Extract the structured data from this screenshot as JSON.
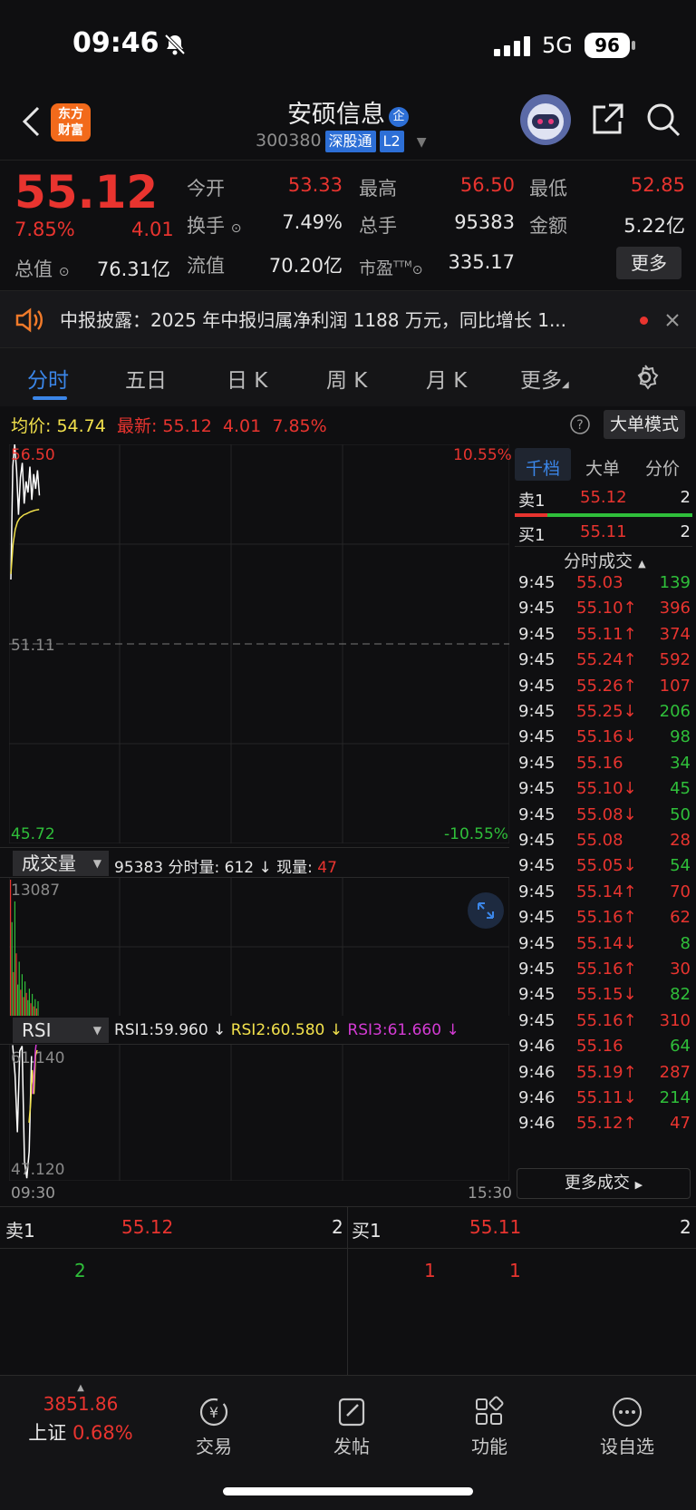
{
  "status": {
    "time": "09:46",
    "network": "5G",
    "battery": "96"
  },
  "header": {
    "logo_line1": "东方",
    "logo_line2": "财富",
    "title": "安硕信息",
    "title_badge": "企",
    "code": "300380",
    "badge1": "深股通",
    "badge2": "L2"
  },
  "quote": {
    "price": "55.12",
    "change_pct": "7.85%",
    "change": "4.01",
    "open_label": "今开",
    "open": "53.33",
    "high_label": "最高",
    "high": "56.50",
    "low_label": "最低",
    "low": "52.85",
    "turnover_label": "换手",
    "turnover": "7.49%",
    "volume_label": "总手",
    "volume": "95383",
    "amount_label": "金额",
    "amount": "5.22亿",
    "mktcap_label": "总值",
    "mktcap": "76.31亿",
    "float_label": "流值",
    "float": "70.20亿",
    "pe_label": "市盈",
    "pe_sup": "TTM",
    "pe": "335.17",
    "more": "更多"
  },
  "notice": {
    "text": "中报披露：2025 年中报归属净利润 1188 万元，同比增长 1..."
  },
  "tabs": [
    "分时",
    "五日",
    "日 K",
    "周 K",
    "月 K",
    "更多"
  ],
  "chart_header": {
    "avg_label": "均价:",
    "avg": "54.74",
    "latest_label": "最新:",
    "latest": "55.12",
    "chg": "4.01",
    "pct": "7.85%",
    "mode": "大单模式"
  },
  "chart_data": [
    {
      "type": "line",
      "title": "分时",
      "ylim": [
        45.72,
        56.5
      ],
      "y_top_label": "56.50",
      "y_mid_label": "51.11",
      "y_bottom_label": "45.72",
      "pct_top_label": "10.55%",
      "pct_bottom_label": "-10.55%",
      "x_start": "09:30",
      "x_end": "15:30",
      "series": [
        {
          "values": [
            52.85,
            55.9,
            56.5,
            55.8,
            54.6,
            55.6,
            56.0,
            54.9,
            55.5,
            55.2,
            55.9,
            55.0,
            55.7,
            55.3,
            55.8,
            55.12
          ]
        },
        {
          "values": [
            53.0,
            53.8,
            54.2,
            54.4,
            54.5,
            54.55,
            54.6,
            54.62,
            54.65,
            54.68,
            54.7,
            54.72,
            54.73,
            54.74
          ]
        }
      ]
    },
    {
      "type": "bar",
      "title": "成交量",
      "ymax_label": "13087",
      "ylim": [
        0,
        13087
      ],
      "values": [
        13087,
        9000,
        4200,
        11000,
        6000,
        3000,
        5200,
        2500,
        4000,
        1800,
        3300,
        2200,
        1500,
        2600,
        1200,
        2100,
        900,
        1600,
        700,
        1400
      ],
      "colors": [
        "red",
        "green",
        "red",
        "green",
        "red",
        "green",
        "green",
        "red",
        "green",
        "red",
        "green",
        "red",
        "green",
        "green",
        "red",
        "green",
        "red",
        "green",
        "red",
        "green"
      ]
    },
    {
      "type": "line",
      "title": "RSI",
      "ylim": [
        47.12,
        61.14
      ],
      "y_top_label": "61.140",
      "y_bottom_label": "47.120",
      "series": [
        {
          "name": "RSI1",
          "values": [
            61.1,
            58.0,
            52.0,
            60.5,
            61.0,
            49.0,
            47.2,
            50.0,
            59.96
          ]
        },
        {
          "name": "RSI2",
          "values": [
            53.0,
            55.0,
            58.5,
            56.0,
            60.0,
            60.58
          ]
        },
        {
          "name": "RSI3",
          "values": [
            56.0,
            58.0,
            60.5,
            61.66
          ]
        }
      ]
    }
  ],
  "volume_head": {
    "dropdown": "成交量",
    "total": "95383",
    "min_label": "分时量:",
    "min_vol": "612",
    "arrow": "↓",
    "now_label": "现量:",
    "now": "47"
  },
  "rsi_head": {
    "dropdown": "RSI",
    "rsi1": "RSI1:59.960 ↓",
    "rsi2": "RSI2:60.580 ↓",
    "rsi3": "RSI3:61.660 ↓"
  },
  "right_panel": {
    "tabs": [
      "千档",
      "大单",
      "分价"
    ],
    "sell1_label": "卖1",
    "sell1_price": "55.12",
    "sell1_vol": "2",
    "buy1_label": "买1",
    "buy1_price": "55.11",
    "buy1_vol": "2",
    "trades_title": "分时成交",
    "trades": [
      {
        "t": "9:45",
        "p": "55.03",
        "v": "139",
        "pc": "red",
        "vc": "green"
      },
      {
        "t": "9:45",
        "p": "55.10↑",
        "v": "396",
        "pc": "red",
        "vc": "red"
      },
      {
        "t": "9:45",
        "p": "55.11↑",
        "v": "374",
        "pc": "red",
        "vc": "red"
      },
      {
        "t": "9:45",
        "p": "55.24↑",
        "v": "592",
        "pc": "red",
        "vc": "red"
      },
      {
        "t": "9:45",
        "p": "55.26↑",
        "v": "107",
        "pc": "red",
        "vc": "red"
      },
      {
        "t": "9:45",
        "p": "55.25↓",
        "v": "206",
        "pc": "red",
        "vc": "green"
      },
      {
        "t": "9:45",
        "p": "55.16↓",
        "v": "98",
        "pc": "red",
        "vc": "green"
      },
      {
        "t": "9:45",
        "p": "55.16",
        "v": "34",
        "pc": "red",
        "vc": "green"
      },
      {
        "t": "9:45",
        "p": "55.10↓",
        "v": "45",
        "pc": "red",
        "vc": "green"
      },
      {
        "t": "9:45",
        "p": "55.08↓",
        "v": "50",
        "pc": "red",
        "vc": "green"
      },
      {
        "t": "9:45",
        "p": "55.08",
        "v": "28",
        "pc": "red",
        "vc": "red"
      },
      {
        "t": "9:45",
        "p": "55.05↓",
        "v": "54",
        "pc": "red",
        "vc": "green"
      },
      {
        "t": "9:45",
        "p": "55.14↑",
        "v": "70",
        "pc": "red",
        "vc": "red"
      },
      {
        "t": "9:45",
        "p": "55.16↑",
        "v": "62",
        "pc": "red",
        "vc": "red"
      },
      {
        "t": "9:45",
        "p": "55.14↓",
        "v": "8",
        "pc": "red",
        "vc": "green"
      },
      {
        "t": "9:45",
        "p": "55.16↑",
        "v": "30",
        "pc": "red",
        "vc": "red"
      },
      {
        "t": "9:45",
        "p": "55.15↓",
        "v": "82",
        "pc": "red",
        "vc": "green"
      },
      {
        "t": "9:45",
        "p": "55.16↑",
        "v": "310",
        "pc": "red",
        "vc": "red"
      },
      {
        "t": "9:46",
        "p": "55.16",
        "v": "64",
        "pc": "red",
        "vc": "green"
      },
      {
        "t": "9:46",
        "p": "55.19↑",
        "v": "287",
        "pc": "red",
        "vc": "red"
      },
      {
        "t": "9:46",
        "p": "55.11↓",
        "v": "214",
        "pc": "red",
        "vc": "green"
      },
      {
        "t": "9:46",
        "p": "55.12↑",
        "v": "47",
        "pc": "red",
        "vc": "red"
      }
    ],
    "more_trades": "更多成交"
  },
  "depth": {
    "sell1_label": "卖1",
    "sell1_price": "55.12",
    "sell1_vol": "2",
    "buy1_label": "买1",
    "buy1_price": "55.11",
    "buy1_vol": "2",
    "sell_detail": "2",
    "buy_detail_a": "1",
    "buy_detail_b": "1"
  },
  "bottom": {
    "index_value": "3851.86",
    "index_name": "上证",
    "index_pct": "0.68%",
    "trade": "交易",
    "post": "发帖",
    "func": "功能",
    "watch": "设自选"
  }
}
